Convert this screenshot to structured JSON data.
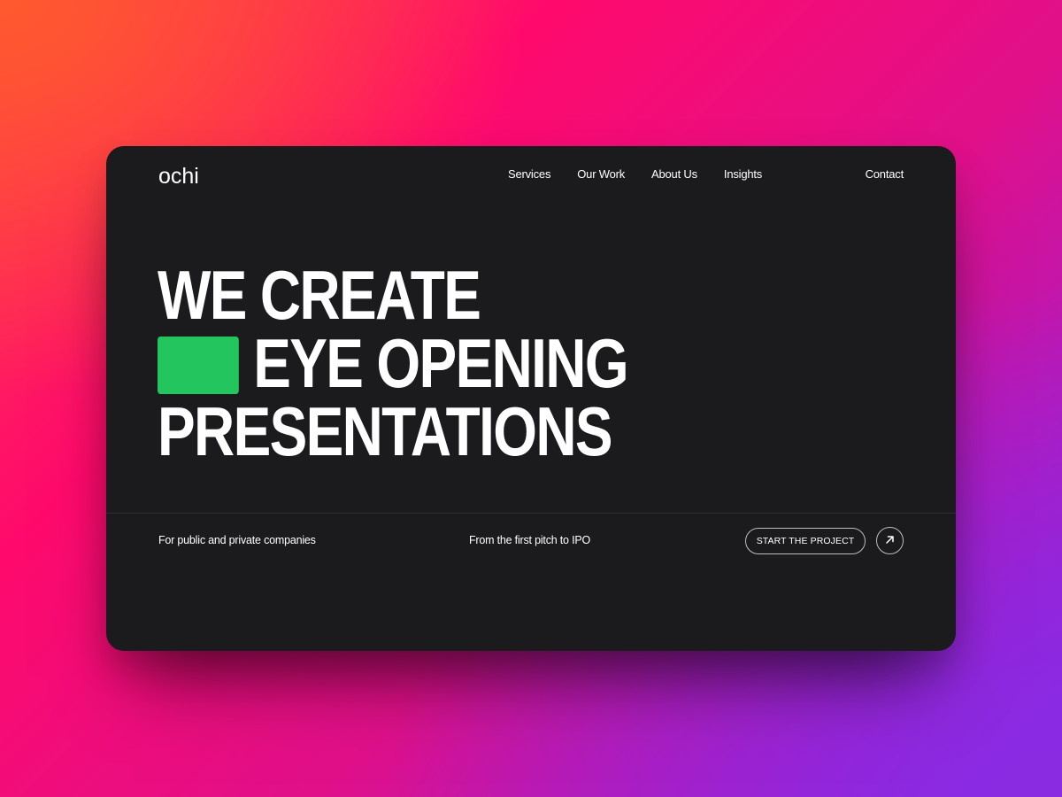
{
  "brand": {
    "logo": "ochi"
  },
  "nav": {
    "items": [
      {
        "label": "Services"
      },
      {
        "label": "Our Work"
      },
      {
        "label": "About Us"
      },
      {
        "label": "Insights"
      }
    ],
    "contact": "Contact"
  },
  "hero": {
    "line1": "WE CREATE",
    "line2": "EYE OPENING",
    "line3": "PRESENTATIONS",
    "accent_color": "#22c55e"
  },
  "footer": {
    "left_text": "For public and private companies",
    "middle_text": "From the first pitch to IPO",
    "cta_label": "START THE PROJECT",
    "cta_icon": "arrow-up-right-icon"
  },
  "colors": {
    "card_background": "#1b1b1d",
    "text": "#ffffff",
    "accent": "#22c55e"
  }
}
